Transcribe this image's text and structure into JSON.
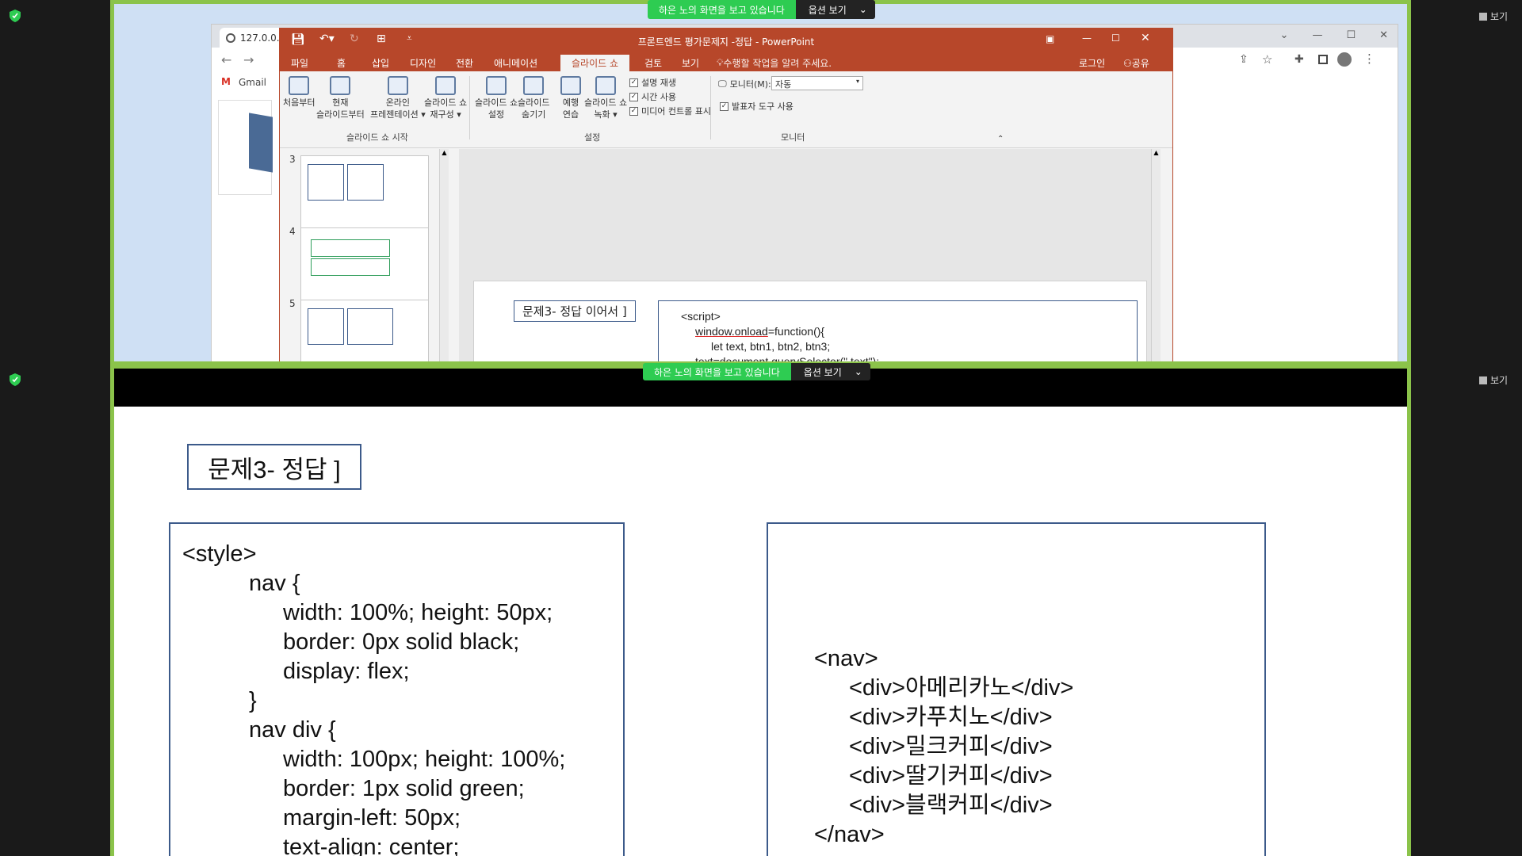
{
  "zoom": {
    "top_notice": {
      "message": "하은 노의 화면을 보고 있습니다",
      "options": "옵션 보기"
    },
    "bottom_notice": {
      "message": "하은 노의 화면을 보고 있습니다",
      "options": "옵션 보기"
    },
    "view_label": "보기"
  },
  "chrome": {
    "tab_title": "127.0.0.",
    "bookmark": "Gmail",
    "win_controls": [
      "⌄",
      "—",
      "☐",
      "✕"
    ]
  },
  "powerpoint": {
    "title": "프론트엔드 평가문제지 -정답 - PowerPoint",
    "tabs": [
      "파일",
      "홈",
      "삽입",
      "디자인",
      "전환",
      "애니메이션",
      "슬라이드 쇼",
      "검토",
      "보기"
    ],
    "active_tab": "슬라이드 쇼",
    "tell_me": "수행할 작업을 알려 주세요.",
    "login": "로그인",
    "share": "공유",
    "ribbon": {
      "buttons": [
        [
          "처음부터",
          ""
        ],
        [
          "현재",
          "슬라이드부터"
        ],
        [
          "온라인",
          "프레젠테이션 ▾"
        ],
        [
          "슬라이드 쇼",
          "재구성 ▾"
        ],
        [
          "슬라이드 쇼",
          "설정"
        ],
        [
          "슬라이드",
          "숨기기"
        ],
        [
          "예행",
          "연습"
        ],
        [
          "슬라이드 쇼",
          "녹화 ▾"
        ]
      ],
      "checks": [
        "설명 재생",
        "시간 사용",
        "미디어 컨트롤 표시"
      ],
      "monitor_label": "모니터(M):",
      "monitor_value": "자동",
      "presenter_view": "발표자 도구 사용",
      "groups": [
        "슬라이드 쇼 시작",
        "설정",
        "모니터"
      ]
    },
    "thumbnails": [
      "3",
      "4",
      "5"
    ],
    "slide": {
      "label": "문제3- 정답 이어서 ]",
      "code": {
        "line1": "<script>",
        "line2a": "window.onload",
        "line2b": "=function(){",
        "line3": "let text, btn1, btn2, btn3;",
        "line4a": "text=",
        "line4b": "document.querySelector",
        "line4c": "(\".text\");"
      }
    }
  },
  "main_slide": {
    "label": "문제3- 정답 ]",
    "left_code": [
      "<style>",
      "nav {",
      "width: 100%; height: 50px;",
      "border: 0px solid black;",
      "display: flex;",
      "}",
      "nav div {",
      "width: 100px; height: 100%;",
      "border: 1px solid green;",
      "margin-left: 50px;",
      "text-align: center;"
    ],
    "right_code": [
      "<nav>",
      "<div>아메리카노</div>",
      "<div>카푸치노</div>",
      "<div>밀크커피</div>",
      "<div>딸기커피</div>",
      "<div>블랙커피</div>",
      "</nav>"
    ]
  }
}
